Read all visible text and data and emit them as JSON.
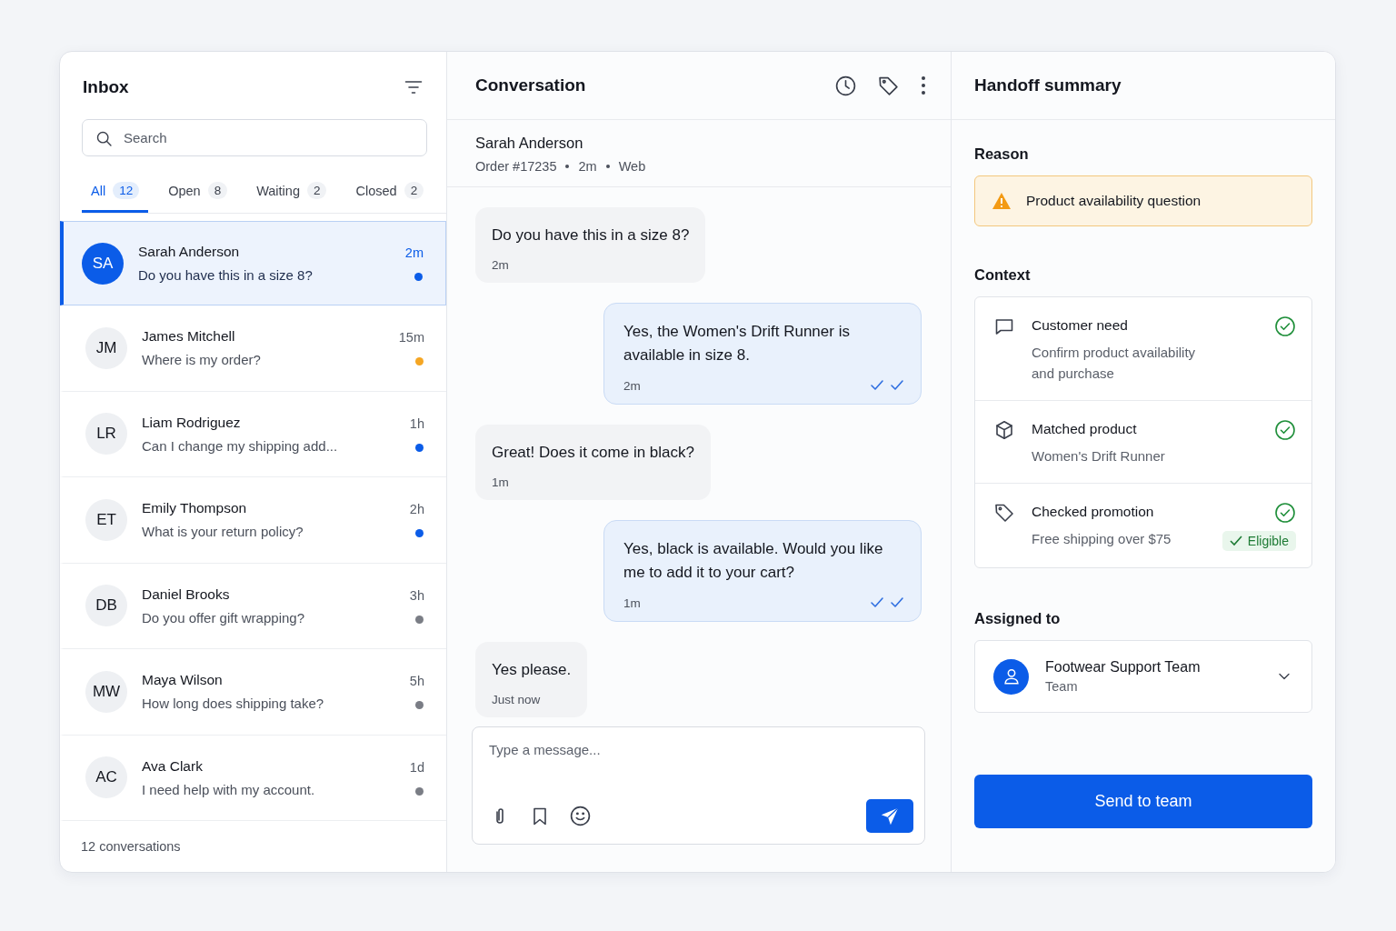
{
  "inbox": {
    "title": "Inbox",
    "search": {
      "placeholder": "Search"
    },
    "tabs": [
      {
        "label": "All",
        "count": "12",
        "selected": true
      },
      {
        "label": "Open",
        "count": "8",
        "selected": false
      },
      {
        "label": "Waiting",
        "count": "2",
        "selected": false
      },
      {
        "label": "Closed",
        "count": "2",
        "selected": false
      }
    ],
    "conversations": [
      {
        "initials": "SA",
        "name": "Sarah Anderson",
        "preview": "Do you have this in a size 8?",
        "time": "2m",
        "color": "#0b5ce8",
        "selected": true
      },
      {
        "initials": "JM",
        "name": "James Mitchell",
        "preview": "Where is my order?",
        "time": "15m",
        "color": "#f5a623",
        "selected": false
      },
      {
        "initials": "LR",
        "name": "Liam Rodriguez",
        "preview": "Can I change my shipping add...",
        "time": "1h",
        "color": "#0b5ce8",
        "selected": false
      },
      {
        "initials": "ET",
        "name": "Emily Thompson",
        "preview": "What is your return policy?",
        "time": "2h",
        "color": "#0b5ce8",
        "selected": false
      },
      {
        "initials": "DB",
        "name": "Daniel Brooks",
        "preview": "Do you offer gift wrapping?",
        "time": "3h",
        "color": "#7a7d85",
        "selected": false
      },
      {
        "initials": "MW",
        "name": "Maya Wilson",
        "preview": "How long does shipping take?",
        "time": "5h",
        "color": "#7a7d85",
        "selected": false
      },
      {
        "initials": "AC",
        "name": "Ava Clark",
        "preview": "I need help with my account.",
        "time": "1d",
        "color": "#7a7d85",
        "selected": false
      }
    ],
    "footer": "12 conversations"
  },
  "conversation": {
    "title": "Conversation",
    "contact": {
      "name": "Sarah Anderson",
      "order": "Order #17235",
      "time": "2m",
      "channel": "Web"
    },
    "messages": [
      {
        "kind": "customer",
        "text": "Do you have this in a size 8?",
        "time": "2m"
      },
      {
        "kind": "agent",
        "text": "Yes, the Women's Drift Runner is available in size 8.",
        "time": "2m"
      },
      {
        "kind": "customer",
        "text": "Great! Does it come in black?",
        "time": "1m"
      },
      {
        "kind": "agent",
        "text": "Yes, black is available. Would you like me to add it to your cart?",
        "time": "1m"
      },
      {
        "kind": "customer",
        "text": "Yes please.",
        "time": "Just now"
      }
    ],
    "composer": {
      "placeholder": "Type a message..."
    }
  },
  "handoff": {
    "title": "Handoff summary",
    "reason_label": "Reason",
    "reason": "Product availability question",
    "context_label": "Context",
    "context": [
      {
        "kind": "chat",
        "title": "Customer need",
        "detail": "Confirm product availability and purchase",
        "checked": true
      },
      {
        "kind": "box",
        "title": "Matched product",
        "detail": "Women's Drift Runner",
        "checked": true
      },
      {
        "kind": "tag",
        "title": "Checked promotion",
        "detail": "Free shipping over $75",
        "checked": true,
        "badge": "Eligible"
      }
    ],
    "assigned_label": "Assigned to",
    "assignee": {
      "name": "Footwear Support Team",
      "type": "Team"
    },
    "button": "Send to team"
  }
}
